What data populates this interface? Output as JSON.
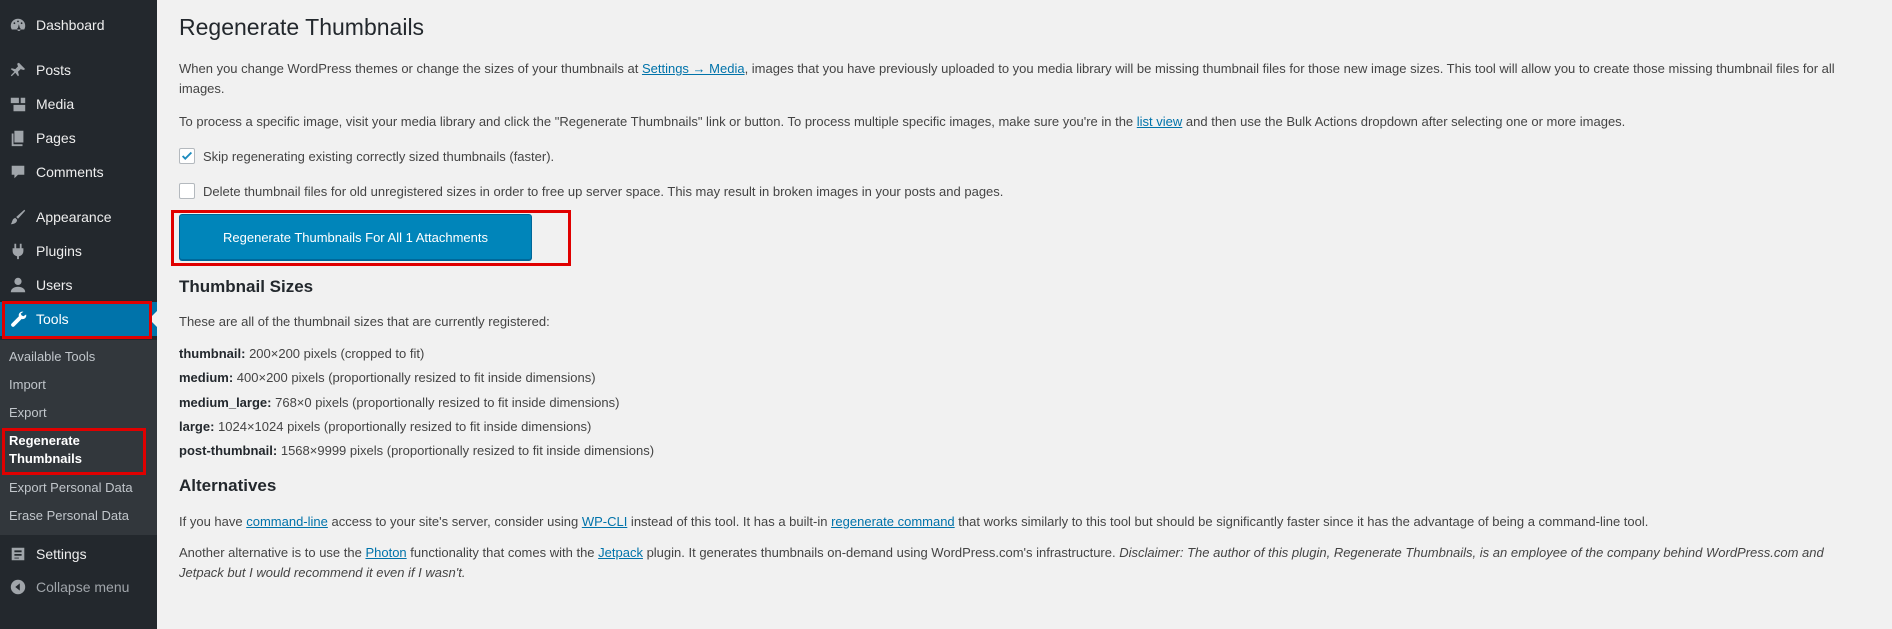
{
  "sidebar": {
    "items": [
      {
        "label": "Dashboard",
        "icon": "dashboard-icon"
      },
      {
        "label": "Posts",
        "icon": "pushpin-icon"
      },
      {
        "label": "Media",
        "icon": "media-icon"
      },
      {
        "label": "Pages",
        "icon": "pages-icon"
      },
      {
        "label": "Comments",
        "icon": "comment-icon"
      },
      {
        "label": "Appearance",
        "icon": "paintbrush-icon"
      },
      {
        "label": "Plugins",
        "icon": "plugin-icon"
      },
      {
        "label": "Users",
        "icon": "user-icon"
      },
      {
        "label": "Tools",
        "icon": "wrench-icon"
      },
      {
        "label": "Settings",
        "icon": "settings-icon"
      },
      {
        "label": "Collapse menu",
        "icon": "collapse-icon"
      }
    ],
    "submenu": [
      "Available Tools",
      "Import",
      "Export",
      "Regenerate Thumbnails",
      "Export Personal Data",
      "Erase Personal Data"
    ]
  },
  "main": {
    "title": "Regenerate Thumbnails",
    "intro": {
      "pre": "When you change WordPress themes or change the sizes of your thumbnails at ",
      "link": "Settings → Media",
      "post": ", images that you have previously uploaded to you media library will be missing thumbnail files for those new image sizes. This tool will allow you to create those missing thumbnail files for all images."
    },
    "process": {
      "pre": "To process a specific image, visit your media library and click the \"Regenerate Thumbnails\" link or button. To process multiple specific images, make sure you're in the ",
      "link": "list view",
      "post": " and then use the Bulk Actions dropdown after selecting one or more images."
    },
    "checkbox_skip": {
      "label": "Skip regenerating existing correctly sized thumbnails (faster).",
      "checked": true
    },
    "checkbox_delete": {
      "label": "Delete thumbnail files for old unregistered sizes in order to free up server space. This may result in broken images in your posts and pages.",
      "checked": false
    },
    "button_label": "Regenerate Thumbnails For All 1 Attachments",
    "sizes_heading": "Thumbnail Sizes",
    "sizes_intro": "These are all of the thumbnail sizes that are currently registered:",
    "sizes": [
      {
        "name": "thumbnail:",
        "desc": "200×200 pixels (cropped to fit)"
      },
      {
        "name": "medium:",
        "desc": "400×200 pixels (proportionally resized to fit inside dimensions)"
      },
      {
        "name": "medium_large:",
        "desc": "768×0 pixels (proportionally resized to fit inside dimensions)"
      },
      {
        "name": "large:",
        "desc": "1024×1024 pixels (proportionally resized to fit inside dimensions)"
      },
      {
        "name": "post-thumbnail:",
        "desc": "1568×9999 pixels (proportionally resized to fit inside dimensions)"
      }
    ],
    "alternatives_heading": "Alternatives",
    "alt1": {
      "t1": "If you have ",
      "l1": "command-line",
      "t2": " access to your site's server, consider using ",
      "l2": "WP-CLI",
      "t3": " instead of this tool. It has a built-in ",
      "l3": "regenerate command",
      "t4": " that works similarly to this tool but should be significantly faster since it has the advantage of being a command-line tool."
    },
    "alt2": {
      "t1": "Another alternative is to use the ",
      "l1": "Photon",
      "t2": " functionality that comes with the ",
      "l2": "Jetpack",
      "t3": " plugin. It generates thumbnails on-demand using WordPress.com's infrastructure. ",
      "disclaimer": "Disclaimer: The author of this plugin, Regenerate Thumbnails, is an employee of the company behind WordPress.com and Jetpack but I would recommend it even if I wasn't."
    }
  },
  "colors": {
    "accent": "#0073aa",
    "button": "#0085ba",
    "sidebar": "#23282d",
    "highlight": "#e00000"
  }
}
